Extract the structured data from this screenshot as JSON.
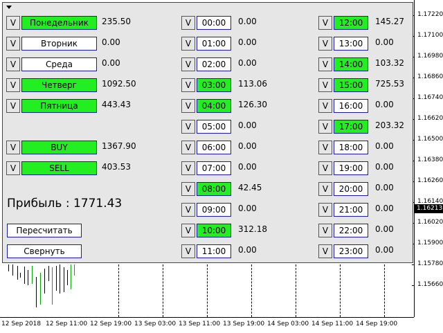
{
  "days": [
    {
      "label": "Понедельник",
      "value": "235.50",
      "active": true
    },
    {
      "label": "Вторник",
      "value": "0.00",
      "active": false
    },
    {
      "label": "Среда",
      "value": "0.00",
      "active": false
    },
    {
      "label": "Четверг",
      "value": "1092.50",
      "active": true
    },
    {
      "label": "Пятница",
      "value": "443.43",
      "active": true
    }
  ],
  "types": [
    {
      "label": "BUY",
      "value": "1367.90",
      "active": true
    },
    {
      "label": "SELL",
      "value": "403.53",
      "active": true
    }
  ],
  "v_label": "V",
  "hours": [
    {
      "label": "00:00",
      "value": "0.00",
      "active": false
    },
    {
      "label": "01:00",
      "value": "0.00",
      "active": false
    },
    {
      "label": "02:00",
      "value": "0.00",
      "active": false
    },
    {
      "label": "03:00",
      "value": "113.06",
      "active": true
    },
    {
      "label": "04:00",
      "value": "126.30",
      "active": true
    },
    {
      "label": "05:00",
      "value": "0.00",
      "active": false
    },
    {
      "label": "06:00",
      "value": "0.00",
      "active": false
    },
    {
      "label": "07:00",
      "value": "0.00",
      "active": false
    },
    {
      "label": "08:00",
      "value": "42.45",
      "active": true
    },
    {
      "label": "09:00",
      "value": "0.00",
      "active": false
    },
    {
      "label": "10:00",
      "value": "312.18",
      "active": true
    },
    {
      "label": "11:00",
      "value": "0.00",
      "active": false
    },
    {
      "label": "12:00",
      "value": "145.27",
      "active": true
    },
    {
      "label": "13:00",
      "value": "0.00",
      "active": false
    },
    {
      "label": "14:00",
      "value": "103.32",
      "active": true
    },
    {
      "label": "15:00",
      "value": "725.53",
      "active": true
    },
    {
      "label": "16:00",
      "value": "0.00",
      "active": false
    },
    {
      "label": "17:00",
      "value": "203.32",
      "active": true
    },
    {
      "label": "18:00",
      "value": "0.00",
      "active": false
    },
    {
      "label": "19:00",
      "value": "0.00",
      "active": false
    },
    {
      "label": "20:00",
      "value": "0.00",
      "active": false
    },
    {
      "label": "21:00",
      "value": "0.00",
      "active": false
    },
    {
      "label": "22:00",
      "value": "0.00",
      "active": false
    },
    {
      "label": "23:00",
      "value": "0.00",
      "active": false
    }
  ],
  "profit": "Прибыль : 1771.43",
  "recalc_label": "Пересчитать",
  "collapse_label": "Свернуть",
  "prices": [
    "1.17220",
    "1.17100",
    "1.16980",
    "1.16860",
    "1.16740",
    "1.16620",
    "1.16500",
    "1.16380",
    "1.16260",
    "1.16140",
    "1.16020",
    "1.15900",
    "1.15780",
    "1.15660"
  ],
  "current_price": "1.16213",
  "times": [
    "12 Sep 2018",
    "12 Sep 11:00",
    "12 Sep 19:00",
    "13 Sep 03:00",
    "13 Sep 11:00",
    "13 Sep 19:00",
    "14 Sep 03:00",
    "14 Sep 11:00",
    "14 Sep 19:00"
  ],
  "colors": {
    "active": "#22ee22",
    "border": "#1a1aa8",
    "panel": "#e6e6e6"
  }
}
